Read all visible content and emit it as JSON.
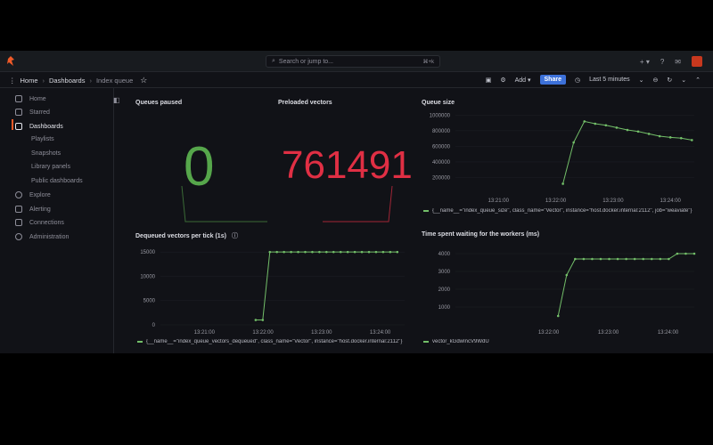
{
  "topbar": {
    "search_placeholder": "Search or jump to...",
    "search_shortcut": "⌘+k",
    "plus_icon": "+ ▾",
    "help_icon": "?",
    "news_icon": "✉"
  },
  "breadcrumb": {
    "home": "Home",
    "dashboards": "Dashboards",
    "current": "Index queue"
  },
  "dashboard_actions": {
    "add": "Add ▾",
    "share": "Share",
    "time_range": "Last 5 minutes"
  },
  "sidebar": {
    "items": [
      {
        "label": "Home",
        "icon": "home-icon"
      },
      {
        "label": "Starred",
        "icon": "star-icon"
      },
      {
        "label": "Dashboards",
        "icon": "apps-icon"
      },
      {
        "label": "Playlists"
      },
      {
        "label": "Snapshots"
      },
      {
        "label": "Library panels"
      },
      {
        "label": "Public dashboards"
      },
      {
        "label": "Explore",
        "icon": "compass-icon"
      },
      {
        "label": "Alerting",
        "icon": "bell-icon"
      },
      {
        "label": "Connections",
        "icon": "link-icon"
      },
      {
        "label": "Administration",
        "icon": "cog-icon"
      }
    ]
  },
  "panels": {
    "queues_paused": {
      "title": "Queues paused",
      "value": "0",
      "color": "#56a64b"
    },
    "preloaded_vectors": {
      "title": "Preloaded vectors",
      "value": "761491",
      "color": "#e02f44"
    },
    "queue_size": {
      "title": "Queue size",
      "legend": "{__name__=\"index_queue_size\", class_name=\"Vector\", instance=\"host.docker.internal:2112\", job=\"weaviate\"}"
    },
    "dequeued": {
      "title": "Dequeued vectors per tick (1s)",
      "legend": "{__name__=\"index_queue_vectors_dequeued\", class_name=\"Vector\", instance=\"host.docker.internal:2112\"}"
    },
    "waiting": {
      "title": "Time spent waiting for the workers (ms)",
      "legend": "vector_kGdwIncV9WdU"
    }
  },
  "chart_data": [
    {
      "type": "line",
      "title": "Queue size",
      "x": [
        "13:21:30",
        "13:21:50",
        "13:22:00",
        "13:22:10",
        "13:22:20",
        "13:22:40",
        "13:23:00",
        "13:23:20",
        "13:23:40",
        "13:24:00",
        "13:24:20",
        "13:24:40",
        "13:25:00"
      ],
      "series": [
        {
          "values": [
            120000,
            650000,
            920000,
            890000,
            870000,
            840000,
            810000,
            790000,
            760000,
            730000,
            715000,
            705000,
            680000
          ]
        }
      ],
      "xticks": [
        "13:21:00",
        "13:22:00",
        "13:23:00",
        "13:24:00",
        "13:25:00"
      ],
      "yticks": [
        "200000",
        "400000",
        "600000",
        "800000",
        "1000000"
      ],
      "ylim": [
        0,
        1050000
      ],
      "color": "#73bf69"
    },
    {
      "type": "line",
      "title": "Dequeued vectors per tick (1s)",
      "series": [
        {
          "values": [
            1000,
            1000,
            15000,
            15000,
            15000,
            15000,
            15000,
            15000,
            15000,
            15000,
            15000,
            15000,
            15000,
            15000,
            15000,
            15000,
            15000,
            15000,
            15000,
            15000,
            15000
          ]
        }
      ],
      "xticks": [
        "13:21:00",
        "13:22:00",
        "13:23:00",
        "13:24:00",
        "13:25:00"
      ],
      "yticks": [
        "0",
        "5000",
        "10000",
        "15000"
      ],
      "ylim": [
        0,
        16500
      ],
      "color": "#73bf69"
    },
    {
      "type": "line",
      "title": "Time spent waiting for the workers (ms)",
      "series": [
        {
          "values": [
            500,
            2800,
            3700,
            3700,
            3700,
            3700,
            3700,
            3700,
            3700,
            3700,
            3700,
            3700,
            3700,
            3700,
            4000,
            4000,
            4000
          ]
        }
      ],
      "xticks": [
        "13:22:00",
        "13:23:00",
        "13:24:00",
        "13:25:00"
      ],
      "yticks": [
        "1000",
        "2000",
        "3000",
        "4000"
      ],
      "ylim": [
        0,
        4500
      ],
      "color": "#73bf69"
    }
  ]
}
